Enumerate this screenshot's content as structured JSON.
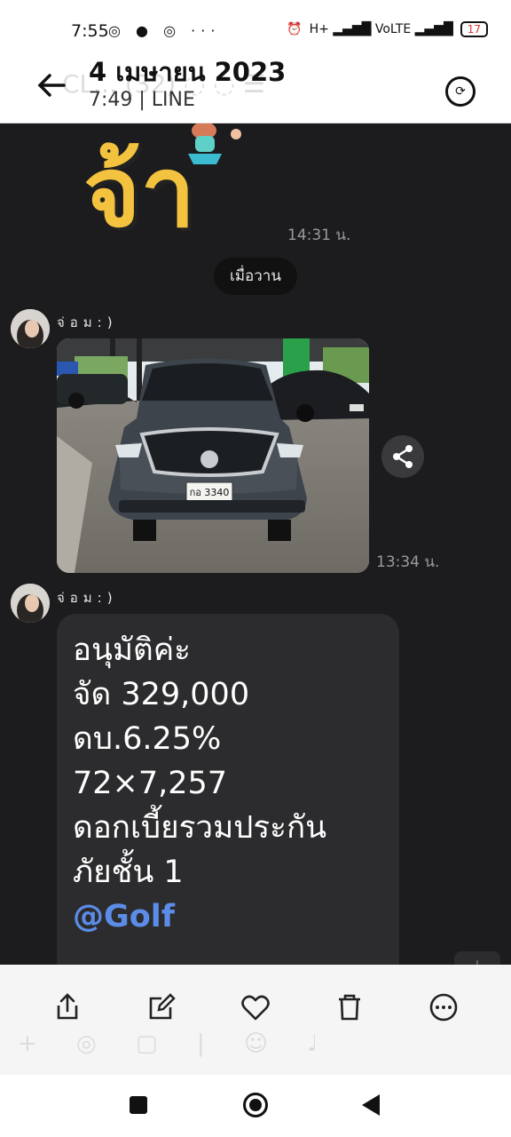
{
  "status_bar": {
    "time": "7:55",
    "app_icons": "◎ ● ◎ ···",
    "signal": "H+ ▂▄▆█ VoLTE ▂▄▆█",
    "battery": "17"
  },
  "header": {
    "back_icon": "arrow-left-icon",
    "date_title": "4 เมษายน 2023",
    "subtitle": "7:49 | LINE",
    "ghost_text": "CL... (32) ◌ ◌ ☰",
    "rotate_icon": "rotate-icon"
  },
  "chat": {
    "sticker_text": "จ้า",
    "sticker_time": "14:31 น.",
    "date_separator": "เมื่อวาน",
    "messages": [
      {
        "sender": "จ่อม:)",
        "type": "image",
        "plate": "กอ 3340",
        "time": "13:34 น."
      },
      {
        "sender": "จ่อม:)",
        "type": "text",
        "lines": [
          "อนุมัติค่ะ",
          "จัด 329,000",
          "ดบ.6.25%",
          "72×7,257",
          "ดอกเบี้ยรวมประกัน",
          "ภัยชั้น 1"
        ],
        "mention": "@Golf"
      }
    ]
  },
  "action_bar": {
    "items": [
      {
        "name": "share",
        "icon": "share-icon"
      },
      {
        "name": "edit",
        "icon": "edit-icon"
      },
      {
        "name": "like",
        "icon": "heart-icon"
      },
      {
        "name": "delete",
        "icon": "trash-icon"
      },
      {
        "name": "more",
        "icon": "more-icon"
      }
    ]
  },
  "colors": {
    "chat_bg": "#1c1c1e",
    "bubble": "#2c2c2e",
    "mention": "#5b8de8",
    "sticker": "#f3c23e"
  }
}
